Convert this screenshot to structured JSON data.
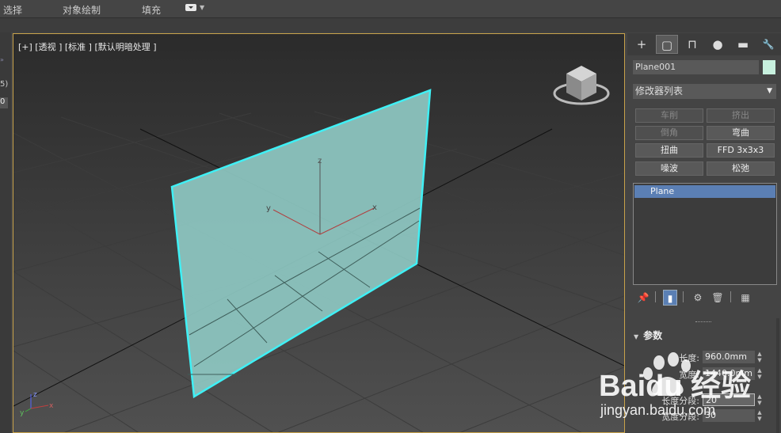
{
  "menu": {
    "select": "选择",
    "object_paint": "对象绘制",
    "populate": "填充"
  },
  "left_strip": {
    "text1": "5)",
    "text2": "0"
  },
  "viewport": {
    "label": "[+] [透视 ] [标准 ] [默认明暗处理 ]",
    "gizmo_axes": {
      "x": "x",
      "y": "y",
      "z": "z"
    },
    "corner_axes": {
      "x": "x",
      "y": "y",
      "z": "z"
    }
  },
  "command_panel": {
    "tabs": [
      {
        "name": "create",
        "glyph": "+"
      },
      {
        "name": "modify",
        "glyph": "▢"
      },
      {
        "name": "hierarchy",
        "glyph": "⊓"
      },
      {
        "name": "motion",
        "glyph": "●"
      },
      {
        "name": "display",
        "glyph": "▬"
      },
      {
        "name": "utilities",
        "glyph": "🔧"
      }
    ],
    "object_name": "Plane001",
    "object_color": "#c7f0de",
    "modifier_list": "修改器列表",
    "modifier_buttons": [
      {
        "label": "车削",
        "enabled": false
      },
      {
        "label": "挤出",
        "enabled": false
      },
      {
        "label": "倒角",
        "enabled": false
      },
      {
        "label": "弯曲",
        "enabled": true
      },
      {
        "label": "扭曲",
        "enabled": true
      },
      {
        "label": "FFD 3x3x3",
        "enabled": true
      },
      {
        "label": "噪波",
        "enabled": true
      },
      {
        "label": "松弛",
        "enabled": true
      }
    ],
    "stack_item": "Plane",
    "rollout_title": "参数",
    "params": [
      {
        "label": "长度:",
        "value": "960.0mm"
      },
      {
        "label": "宽度:",
        "value": "1440.0mm"
      },
      {
        "label": "长度分段:",
        "value": "20"
      },
      {
        "label": "宽度分段:",
        "value": "30"
      }
    ]
  },
  "watermark": {
    "text": "Baidu 经验",
    "url": "jingyan.baidu.com"
  },
  "colors": {
    "selection_cyan": "#3ff0f5",
    "plane_fill": "#8ec8c2",
    "viewport_border": "#c8a24a",
    "stack_select": "#5b7fb4"
  }
}
